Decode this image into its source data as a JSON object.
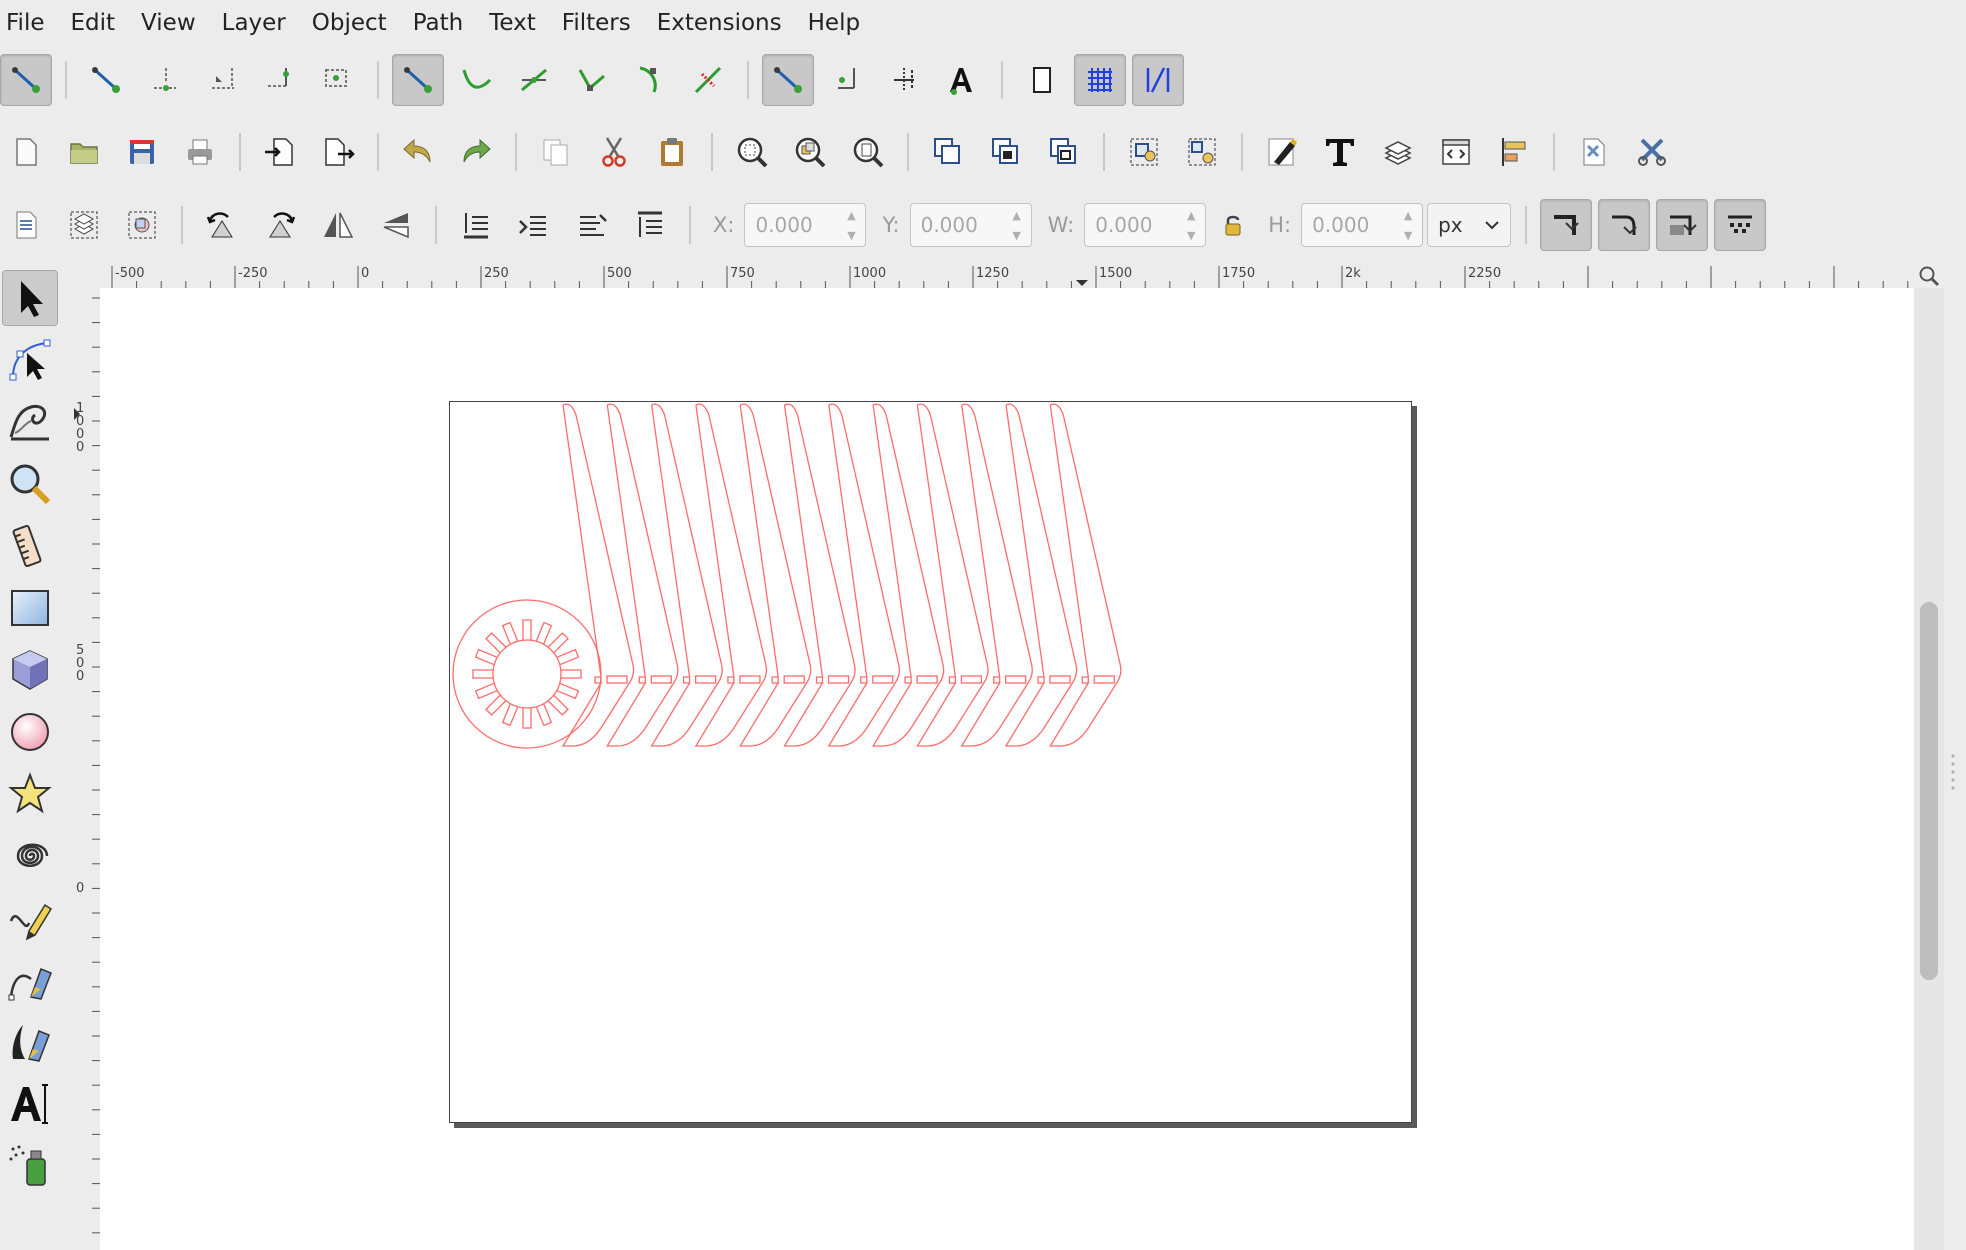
{
  "menubar": {
    "items": [
      "File",
      "Edit",
      "View",
      "Layer",
      "Object",
      "Path",
      "Text",
      "Filters",
      "Extensions",
      "Help"
    ]
  },
  "controls": {
    "x_label": "X:",
    "x_value": "0.000",
    "y_label": "Y:",
    "y_value": "0.000",
    "w_label": "W:",
    "w_value": "0.000",
    "h_label": "H:",
    "h_value": "0.000",
    "unit": "px"
  },
  "ruler": {
    "horizontal_labels": [
      "-500",
      "-250",
      "0",
      "250",
      "500",
      "750",
      "1000",
      "1250",
      "1500",
      "1750",
      "2k",
      "2250"
    ],
    "vertical_labels": [
      "1000",
      "500",
      "0"
    ]
  },
  "colors": {
    "drawing_stroke": "#ff6b6b",
    "page_border": "#444444",
    "page_shadow": "#5a5a5a",
    "canvas": "#ffffff",
    "chrome": "#ececec"
  },
  "icons": {
    "snap_toolbar": [
      "snap-enable-icon",
      "snap-bbox-icon",
      "snap-bbox-edge-icon",
      "snap-bbox-corner-icon",
      "snap-bbox-midpoint-icon",
      "snap-bbox-center-icon",
      "snap-nodes-icon",
      "snap-path-icon",
      "snap-path-intersection-icon",
      "snap-cusp-nodes-icon",
      "snap-smooth-nodes-icon",
      "snap-line-midpoint-icon",
      "snap-others-icon",
      "snap-object-center-icon",
      "snap-rotation-center-icon",
      "snap-text-baseline-icon",
      "snap-page-border-icon",
      "snap-grid-icon",
      "snap-guide-icon"
    ],
    "tools": [
      "selector-tool-icon",
      "node-tool-icon",
      "tweak-tool-icon",
      "zoom-tool-icon",
      "measure-tool-icon",
      "rect-tool-icon",
      "3dbox-tool-icon",
      "ellipse-tool-icon",
      "star-tool-icon",
      "spiral-tool-icon",
      "pencil-tool-icon",
      "pen-tool-icon",
      "calligraphy-tool-icon",
      "text-tool-icon",
      "spray-tool-icon"
    ]
  }
}
